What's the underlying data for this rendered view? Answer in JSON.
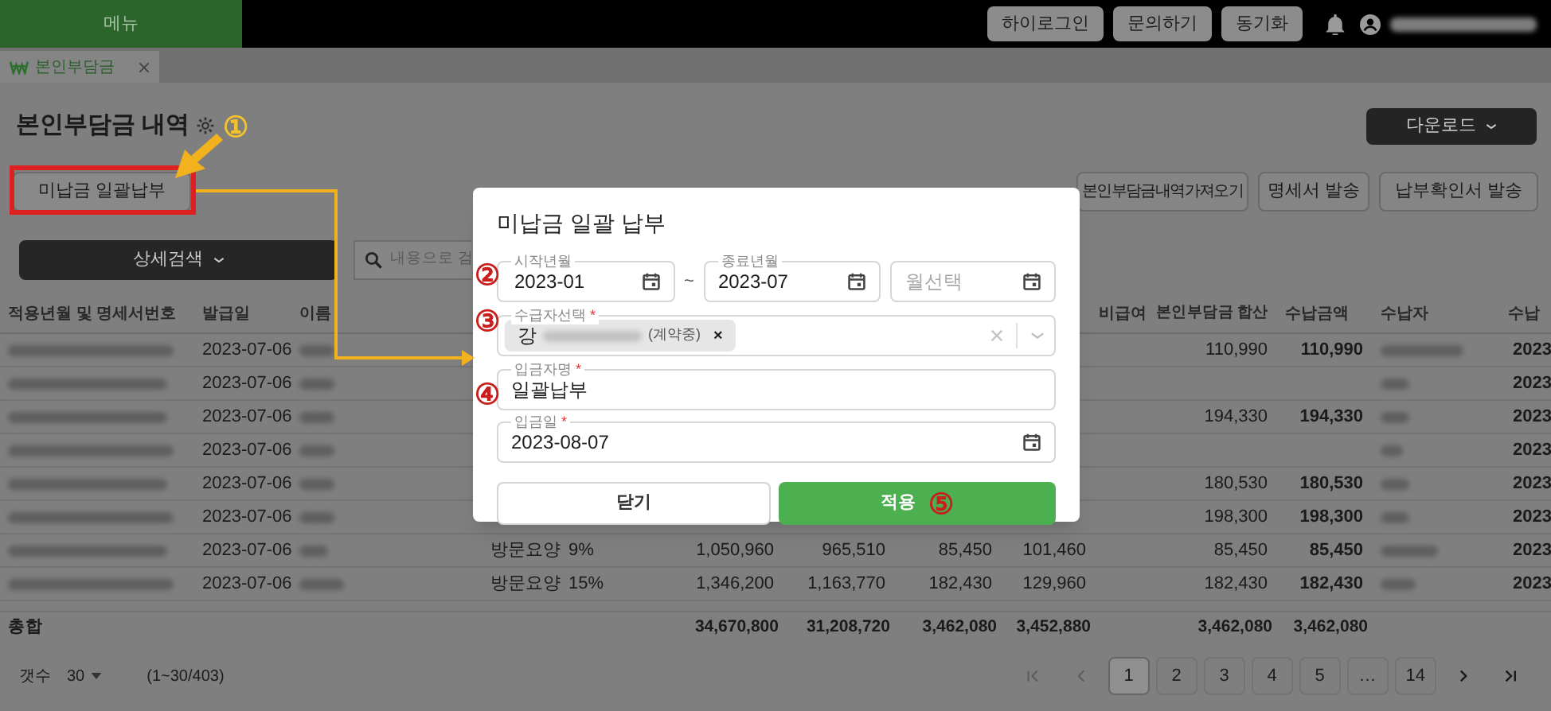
{
  "top_bar": {
    "menu": "메뉴",
    "buttons": [
      "하이로그인",
      "문의하기",
      "동기화"
    ]
  },
  "tabs": [
    {
      "label": "본인부담금",
      "selected": true
    }
  ],
  "page": {
    "title": "본인부담금 내역",
    "download": "다운로드"
  },
  "actions": {
    "bulk_pay": "미납금 일괄납부",
    "buttons": [
      "본인부담금내역가져오기",
      "명세서 발송",
      "납부확인서 발송"
    ]
  },
  "search": {
    "detail": "상세검색",
    "placeholder": "내용으로 검"
  },
  "table": {
    "columns": [
      "적용년월 및 명세서번호",
      "발급일",
      "이름",
      "비급여",
      "본인부담금 합산",
      "수납금액",
      "수납자",
      "수납"
    ],
    "rows": [
      {
        "issued": "2023-07-06",
        "copay": "110,990",
        "paid": "110,990",
        "paid_on": "2023"
      },
      {
        "issued": "2023-07-06",
        "paid_on": "2023"
      },
      {
        "issued": "2023-07-06",
        "copay": "194,330",
        "paid": "194,330",
        "paid_on": "2023"
      },
      {
        "issued": "2023-07-06",
        "paid_on": "2023"
      },
      {
        "issued": "2023-07-06",
        "copay": "180,530",
        "paid": "180,530",
        "paid_on": "2023"
      },
      {
        "issued": "2023-07-06",
        "copay": "198,300",
        "paid": "198,300",
        "paid_on": "2023"
      },
      {
        "issued": "2023-07-06",
        "care_type": "방문요양",
        "rate": "9%",
        "amount_1": "1,050,960",
        "amount_2": "965,510",
        "amount_3": "85,450",
        "amount_4": "101,460",
        "copay": "85,450",
        "paid": "85,450",
        "paid_on": "2023"
      },
      {
        "issued": "2023-07-06",
        "care_type": "방문요양",
        "rate": "15%",
        "amount_1": "1,346,200",
        "amount_2": "1,163,770",
        "amount_3": "182,430",
        "amount_4": "129,960",
        "copay": "182,430",
        "paid": "182,430",
        "paid_on": "2023"
      }
    ],
    "total": {
      "id": "총합",
      "amount_1": "34,670,800",
      "amount_2": "31,208,720",
      "amount_3": "3,462,080",
      "amount_4": "3,452,880",
      "copay": "3,462,080",
      "paid": "3,462,080"
    }
  },
  "footer": {
    "count_label": "갯수",
    "page_size": "30",
    "range": "(1~30/403)",
    "pages": [
      {
        "label": "1",
        "selected": true
      },
      {
        "label": "2",
        "selected": false
      },
      {
        "label": "3",
        "selected": false
      },
      {
        "label": "4",
        "selected": false
      },
      {
        "label": "5",
        "selected": false
      },
      {
        "label": "…",
        "selected": false
      },
      {
        "label": "14",
        "selected": false
      }
    ]
  },
  "modal": {
    "title": "미납금 일괄 납부",
    "start": {
      "label": "시작년월",
      "value": "2023-01"
    },
    "separator": "~",
    "end": {
      "label": "종료년월",
      "value": "2023-07"
    },
    "month": {
      "placeholder": "월선택"
    },
    "recipient": {
      "label": "수급자선택",
      "required_mark": "*",
      "chip_prefix": "강",
      "chip_suffix": "(계약중)",
      "chip_remove": "×"
    },
    "depositor": {
      "label": "입금자명",
      "required_mark": "*",
      "value": "일괄납부"
    },
    "deposit_date": {
      "label": "입금일",
      "required_mark": "*",
      "value": "2023-08-07"
    },
    "buttons": [
      {
        "label": "닫기",
        "kind": "secondary"
      },
      {
        "label": "적용",
        "kind": "primary"
      }
    ]
  },
  "annotations": [
    {
      "label": "①",
      "color": "#f2c12e"
    },
    {
      "label": "②",
      "color": "#c81e1e"
    },
    {
      "label": "③",
      "color": "#c81e1e"
    },
    {
      "label": "④",
      "color": "#c81e1e"
    },
    {
      "label": "⑤",
      "color": "#c81e1e"
    }
  ]
}
